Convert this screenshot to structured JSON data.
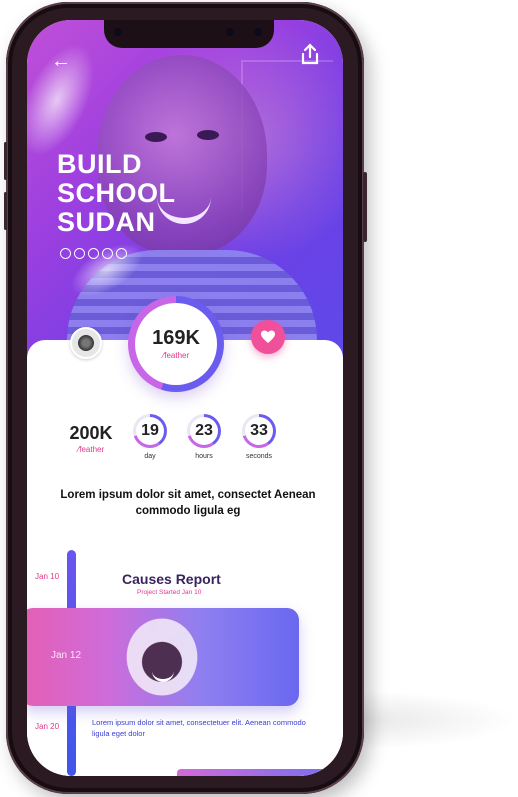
{
  "hero": {
    "title": "BUILD\nSCHOOL\nSUDAN",
    "back_icon": "arrow-left-icon",
    "share_icon": "share-icon"
  },
  "stats": {
    "main_value": "169K",
    "main_unit": "feather",
    "goal_value": "200K",
    "goal_unit": "feather"
  },
  "countdown": [
    {
      "value": "19",
      "label": "day"
    },
    {
      "value": "23",
      "label": "hours"
    },
    {
      "value": "33",
      "label": "seconds"
    }
  ],
  "description": "Lorem ipsum dolor sit amet, consectet Aenean commodo ligula eg",
  "timeline": {
    "title": "Causes Report",
    "subtitle": "Project Started Jan 10",
    "dates": [
      "Jan 10",
      "Jan 12",
      "Jan 20"
    ],
    "entry_text": "Lorem ipsum dolor sit amet, consectetuer elit. Aenean commodo ligula eget dolor"
  },
  "colors": {
    "accent_pink": "#e2388c",
    "accent_purple": "#6b5cf0",
    "heart": "#f0509a"
  }
}
